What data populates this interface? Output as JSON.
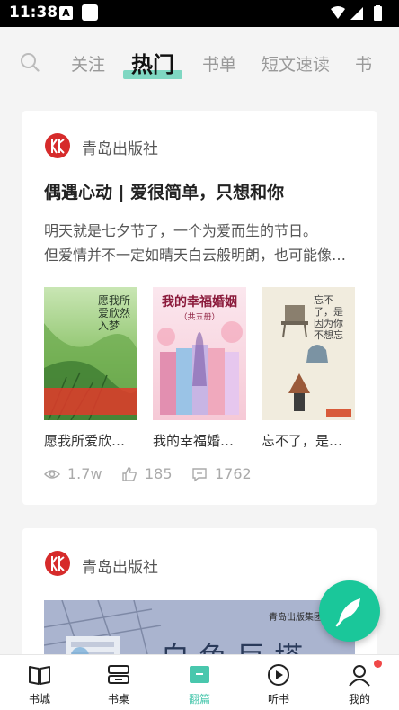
{
  "status_bar": {
    "time": "11:38",
    "notice_glyph": "A"
  },
  "top_tabs": [
    {
      "label": "关注"
    },
    {
      "label": "热门",
      "active": true
    },
    {
      "label": "书单"
    },
    {
      "label": "短文速读"
    },
    {
      "label": "书"
    }
  ],
  "feed": [
    {
      "publisher": "青岛出版社",
      "title": "偶遇心动 | 爱很简单，只想和你",
      "summary_lines": [
        "明天就是七夕节了，一个为爱而生的节日。",
        "但爱情并不一定如晴天白云般明朗，也可能像…"
      ],
      "books": [
        {
          "name": "愿我所爱欣然入",
          "cover_text": "愿我所爱欣然入梦"
        },
        {
          "name": "我的幸福婚姻…",
          "cover_text": "我的幸福婚姻",
          "cover_sub": "（共五册）"
        },
        {
          "name": "忘不了，是因…",
          "cover_text": "忘不了，是因为你不想忘"
        }
      ],
      "stats": {
        "views": "1.7w",
        "likes": "185",
        "comments": "1762"
      }
    },
    {
      "publisher": "青岛出版社",
      "banner_text": "白色巨塔",
      "banner_tag": "青岛出版集团 | 青"
    }
  ],
  "bottom_nav": [
    {
      "label": "书城"
    },
    {
      "label": "书桌"
    },
    {
      "label": "翻篇",
      "active": true
    },
    {
      "label": "听书"
    },
    {
      "label": "我的",
      "badge": true
    }
  ],
  "colors": {
    "accent": "#1ac79a",
    "tab_underline": "#7fd7c2",
    "publisher_red": "#d62b2b"
  }
}
